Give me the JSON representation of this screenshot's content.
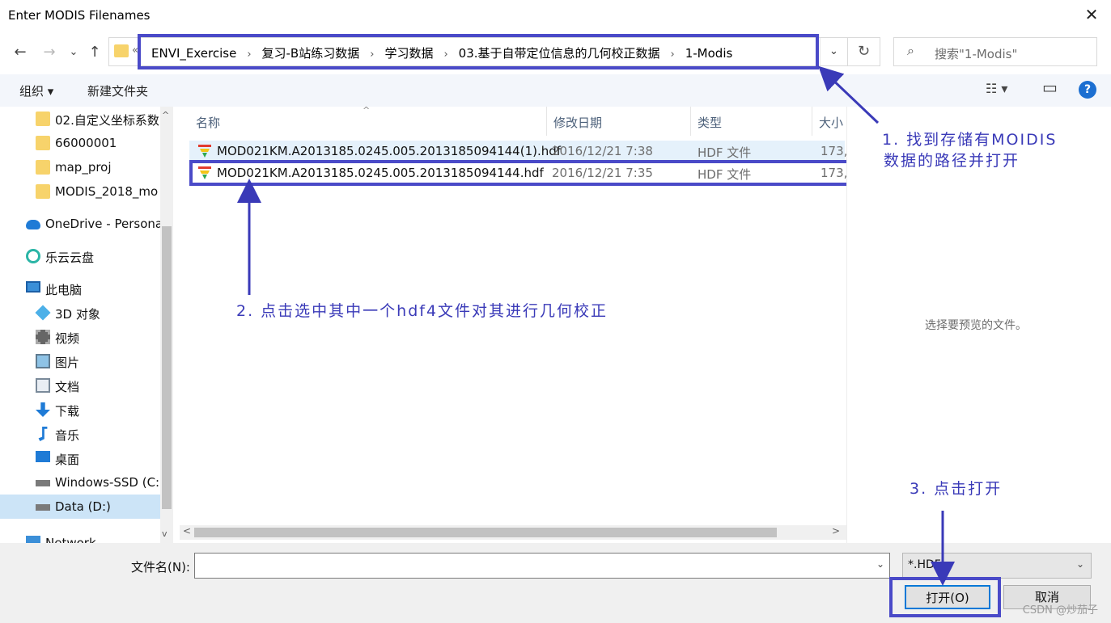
{
  "window": {
    "title": "Enter MODIS Filenames",
    "close_glyph": "✕"
  },
  "nav": {
    "back_glyph": "←",
    "forward_glyph": "→",
    "recent_glyph": "⌄",
    "up_glyph": "↑",
    "overflow_glyph": "«",
    "breadcrumbs": [
      "ENVI_Exercise",
      "复习-B站练习数据",
      "学习数据",
      "03.基于自带定位信息的几何校正数据",
      "1-Modis"
    ],
    "separator": "›",
    "dropdown_glyph": "⌄",
    "refresh_glyph": "↻",
    "search_icon_glyph": "⌕",
    "search_placeholder": "搜索\"1-Modis\""
  },
  "commandbar": {
    "organize_label": "组织 ▾",
    "new_folder_label": "新建文件夹",
    "view_glyph": "☷ ▾",
    "pane_glyph": "▭",
    "help_glyph": "?"
  },
  "sidebar": {
    "items": [
      {
        "label": "02.自定义坐标系数",
        "icon": "folder-icon",
        "indent": 1
      },
      {
        "label": "66000001",
        "icon": "folder-icon",
        "indent": 1
      },
      {
        "label": "map_proj",
        "icon": "folder-icon",
        "indent": 1
      },
      {
        "label": "MODIS_2018_mo",
        "icon": "folder-icon",
        "indent": 1
      },
      {
        "label": "OneDrive - Persona",
        "icon": "cloud-icon",
        "indent": 0
      },
      {
        "label": "乐云云盘",
        "icon": "lecloud-icon",
        "indent": 0
      },
      {
        "label": "此电脑",
        "icon": "computer-icon",
        "indent": 0
      },
      {
        "label": "3D 对象",
        "icon": "cube-icon",
        "indent": 1
      },
      {
        "label": "视频",
        "icon": "video-icon",
        "indent": 1
      },
      {
        "label": "图片",
        "icon": "picture-icon",
        "indent": 1
      },
      {
        "label": "文档",
        "icon": "document-icon",
        "indent": 1
      },
      {
        "label": "下载",
        "icon": "download-icon",
        "indent": 1
      },
      {
        "label": "音乐",
        "icon": "music-icon",
        "indent": 1
      },
      {
        "label": "桌面",
        "icon": "desktop-icon",
        "indent": 1
      },
      {
        "label": "Windows-SSD (C:",
        "icon": "drive-icon",
        "indent": 1
      },
      {
        "label": "Data (D:)",
        "icon": "drive-icon",
        "indent": 1,
        "selected": true
      },
      {
        "label": "Network",
        "icon": "network-icon",
        "indent": 0
      }
    ],
    "scroll_up_glyph": "^",
    "scroll_down_glyph": "v"
  },
  "filelist": {
    "columns": [
      "名称",
      "修改日期",
      "类型",
      "大小"
    ],
    "sort_glyph": "^",
    "rows": [
      {
        "name": "MOD021KM.A2013185.0245.005.2013185094144(1).hdf",
        "date": "2016/12/21 7:38",
        "type": "HDF 文件",
        "size": "173,",
        "hover": true
      },
      {
        "name": "MOD021KM.A2013185.0245.005.2013185094144.hdf",
        "date": "2016/12/21 7:35",
        "type": "HDF 文件",
        "size": "173,",
        "hover": false
      }
    ],
    "scroll_left_glyph": "<",
    "scroll_right_glyph": ">"
  },
  "preview": {
    "message": "选择要预览的文件。"
  },
  "bottom": {
    "filename_label": "文件名(N):",
    "filename_value": "",
    "filename_dropdown_glyph": "⌄",
    "filter_value": "*.HDF",
    "filter_dropdown_glyph": "⌄",
    "open_label": "打开(O)",
    "cancel_label": "取消"
  },
  "annotations": {
    "step1_line1": "1. 找到存储有MOIDIS",
    "step1_line2": "数据的路径并打开",
    "step2": "2. 点击选中其中一个hdf4文件对其进行几何校正",
    "step3": "3. 点击打开",
    "color": "#3a3ab8"
  },
  "watermark": "CSDN @炒茄子"
}
